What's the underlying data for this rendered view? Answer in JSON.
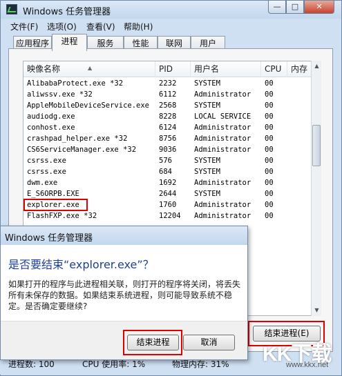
{
  "window": {
    "title": "Windows 任务管理器"
  },
  "menu": [
    "文件(F)",
    "选项(O)",
    "查看(V)",
    "帮助(H)"
  ],
  "tabs": [
    "应用程序",
    "进程",
    "服务",
    "性能",
    "联网",
    "用户"
  ],
  "active_tab": "进程",
  "columns": {
    "name": "映像名称",
    "pid": "PID",
    "user": "用户名",
    "cpu": "CPU",
    "mem": "内存"
  },
  "processes": [
    {
      "name": "AlibabaProtect.exe *32",
      "pid": "2232",
      "user": "SYSTEM",
      "cpu": "00"
    },
    {
      "name": "aliwssv.exe *32",
      "pid": "6112",
      "user": "Administrator",
      "cpu": "00"
    },
    {
      "name": "AppleMobileDeviceService.exe",
      "pid": "2568",
      "user": "SYSTEM",
      "cpu": "00"
    },
    {
      "name": "audiodg.exe",
      "pid": "8228",
      "user": "LOCAL SERVICE",
      "cpu": "00"
    },
    {
      "name": "conhost.exe",
      "pid": "6124",
      "user": "Administrator",
      "cpu": "00"
    },
    {
      "name": "crashpad_helper.exe *32",
      "pid": "8756",
      "user": "Administrator",
      "cpu": "00"
    },
    {
      "name": "CS6ServiceManager.exe *32",
      "pid": "9036",
      "user": "Administrator",
      "cpu": "00"
    },
    {
      "name": "csrss.exe",
      "pid": "576",
      "user": "SYSTEM",
      "cpu": "00"
    },
    {
      "name": "csrss.exe",
      "pid": "684",
      "user": "SYSTEM",
      "cpu": "00"
    },
    {
      "name": "dwm.exe",
      "pid": "1692",
      "user": "Administrator",
      "cpu": "00"
    },
    {
      "name": "E_S6ORPB.EXE",
      "pid": "2644",
      "user": "SYSTEM",
      "cpu": "00"
    },
    {
      "name": "explorer.exe",
      "pid": "1760",
      "user": "Administrator",
      "cpu": "00"
    },
    {
      "name": "FlashFXP.exe *32",
      "pid": "12204",
      "user": "Administrator",
      "cpu": "00"
    }
  ],
  "end_process_button": "结束进程(E)",
  "status": {
    "processes": "进程数: 100",
    "cpu": "CPU 使用率: 1%",
    "memory": "物理内存: 31%"
  },
  "dialog": {
    "title": "Windows 任务管理器",
    "heading": "是否要结束“explorer.exe”？",
    "body": "如果打开的程序与此进程相关联，则打开的程序将关闭，将丢失所有未保存的数据。如果结束系统进程，则可能导致系统不稳定。是否确定要继续?",
    "confirm": "结束进程",
    "cancel": "取消"
  },
  "watermark": {
    "logo": "KK下载",
    "url": "www.kkx.net"
  }
}
